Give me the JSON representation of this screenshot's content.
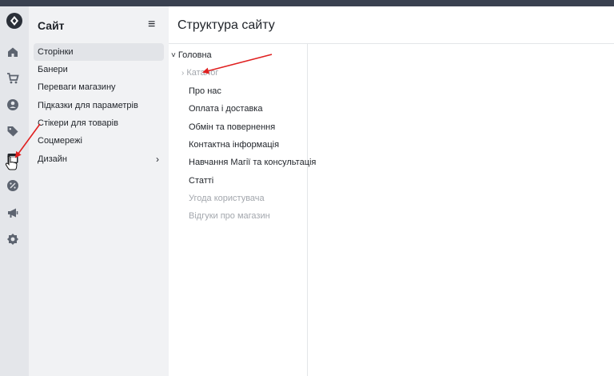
{
  "sidebar": {
    "title": "Сайт",
    "collapse_icon": "≡",
    "items": [
      {
        "label": "Сторінки",
        "active": true
      },
      {
        "label": "Банери"
      },
      {
        "label": "Переваги магазину"
      },
      {
        "label": "Підказки для параметрів"
      },
      {
        "label": "Стікери для товарів"
      },
      {
        "label": "Соцмережі"
      },
      {
        "label": "Дизайн",
        "chevron": "›"
      }
    ]
  },
  "rail": {
    "icons": [
      "logo-icon",
      "home-icon",
      "cart-icon",
      "user-icon",
      "tag-icon",
      "site-icon",
      "discount-icon",
      "megaphone-icon",
      "settings-icon"
    ]
  },
  "main": {
    "title": "Структура сайту"
  },
  "tree": {
    "root": {
      "label": "Головна",
      "chevron": "˅"
    },
    "items": [
      {
        "label": "Каталог",
        "chevron": "›",
        "muted": true
      },
      {
        "label": "Про нас"
      },
      {
        "label": "Оплата і доставка"
      },
      {
        "label": "Обмін та повернення"
      },
      {
        "label": "Контактна інформація"
      },
      {
        "label": "Навчання Магії та консультація"
      },
      {
        "label": "Статті"
      },
      {
        "label": "Угода користувача",
        "muted": true
      },
      {
        "label": "Відгуки про магазин",
        "muted": true
      }
    ]
  },
  "colors": {
    "annotation_arrow": "#e02020",
    "rail_bg": "#e4e6ea",
    "sidebar_bg": "#f1f2f4",
    "topbar": "#3a4150"
  }
}
